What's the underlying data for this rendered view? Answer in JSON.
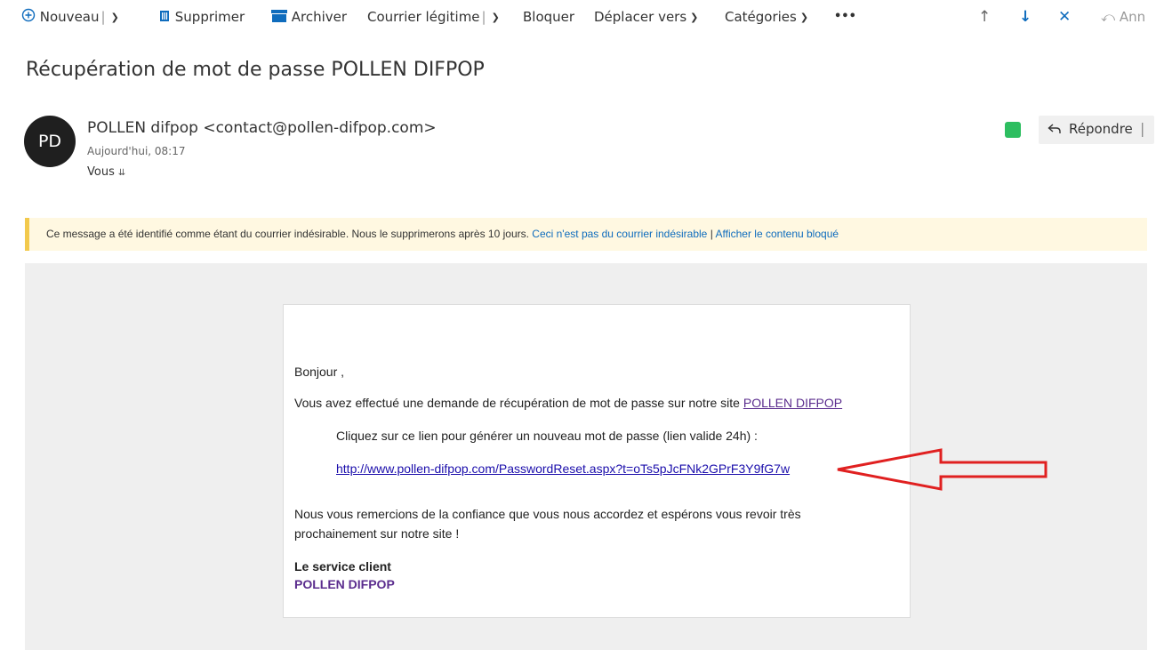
{
  "toolbar": {
    "new_label": "Nouveau",
    "delete_label": "Supprimer",
    "archive_label": "Archiver",
    "not_junk_label": "Courrier légitime",
    "block_label": "Bloquer",
    "move_label": "Déplacer vers",
    "categories_label": "Catégories",
    "more_label": "•••",
    "undo_label": "Ann"
  },
  "email": {
    "subject": "Récupération de mot de passe POLLEN DIFPOP",
    "sender": {
      "initials": "PD",
      "display": "POLLEN difpop <contact@pollen-difpop.com>",
      "date": "Aujourd'hui, 08:17",
      "to": "Vous"
    },
    "reply_label": "Répondre"
  },
  "junk_banner": {
    "message": "Ce message a été identifié comme étant du courrier indésirable. Nous le supprimerons après 10 jours.",
    "not_junk_link": "Ceci n'est pas du courrier indésirable",
    "separator": "|",
    "show_blocked_link": "Afficher le contenu bloqué",
    "accent_color": "#f2c94c"
  },
  "message_body": {
    "greeting": "Bonjour ,",
    "intro": "Vous avez effectué une demande de récupération de mot de passe sur notre site",
    "site_link": "POLLEN DIFPOP",
    "instruction": "Cliquez sur ce lien pour générer un nouveau mot de passe (lien valide 24h) :",
    "reset_link": "http://www.pollen-difpop.com/PasswordReset.aspx?t=oTs5pJcFNk2GPrF3Y9fG7w",
    "thanks_line1": "Nous vous remercions de la confiance que vous nous accordez et espérons vous revoir très",
    "thanks_line2": "prochainement sur notre site !",
    "signature_team": "Le service client",
    "signature_brand": "POLLEN DIFPOP"
  },
  "annotation": {
    "type": "red-arrow-pointing-left",
    "color": "#e02020"
  }
}
